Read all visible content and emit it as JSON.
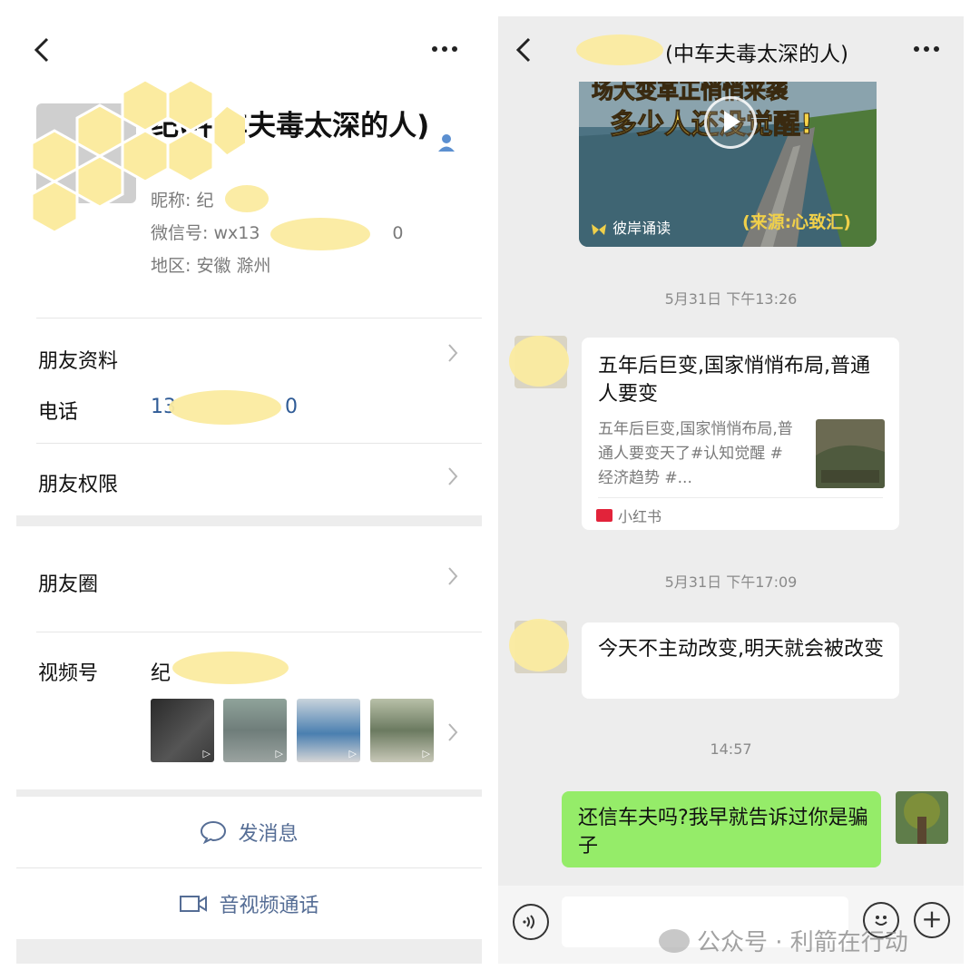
{
  "left": {
    "back_icon": "chevron-left-icon",
    "more_icon": "ellipsis-icon",
    "name_text": "纪(中车夫毒太深的人)",
    "nickname_line": "昵称: 纪",
    "wechat_id_line": "微信号: wx13",
    "wechat_id_tail": "0",
    "region_line": "地区: 安徽 滁州",
    "friend_profile_label": "朋友资料",
    "phone_label": "电话",
    "phone_value_prefix": "13",
    "phone_value_suffix": "0",
    "friend_permission_label": "朋友权限",
    "moments_label": "朋友圈",
    "channels_label": "视频号",
    "channels_value": "纪",
    "send_message_label": "发消息",
    "video_call_label": "音视频通话"
  },
  "right": {
    "title": "(中车夫毒太深的人)",
    "video_card": {
      "line1": "场大变革正悄悄来袭",
      "line2": "多少人还没觉醒!",
      "source": "(来源:心致汇)",
      "brand": "彼岸诵读"
    },
    "timestamp1": "5月31日 下午13:26",
    "link_card": {
      "title": "五年后巨变,国家悄悄布局,普通人要变",
      "desc": "五年后巨变,国家悄悄布局,普通人要变天了#认知觉醒 #经济趋势 #...",
      "source": "小红书"
    },
    "timestamp2": "5月31日 下午17:09",
    "text_msg": "今天不主动改变,明天就会被改变",
    "timestamp3": "14:57",
    "my_msg": "还信车夫吗?我早就告诉过你是骗子"
  },
  "watermark": "公众号 · 利箭在行动",
  "colors": {
    "link_blue": "#2f5b96",
    "action_blue": "#556d95",
    "chat_bg": "#ededed",
    "my_bubble": "#95ec69",
    "redact_yellow": "#fbeba0"
  }
}
